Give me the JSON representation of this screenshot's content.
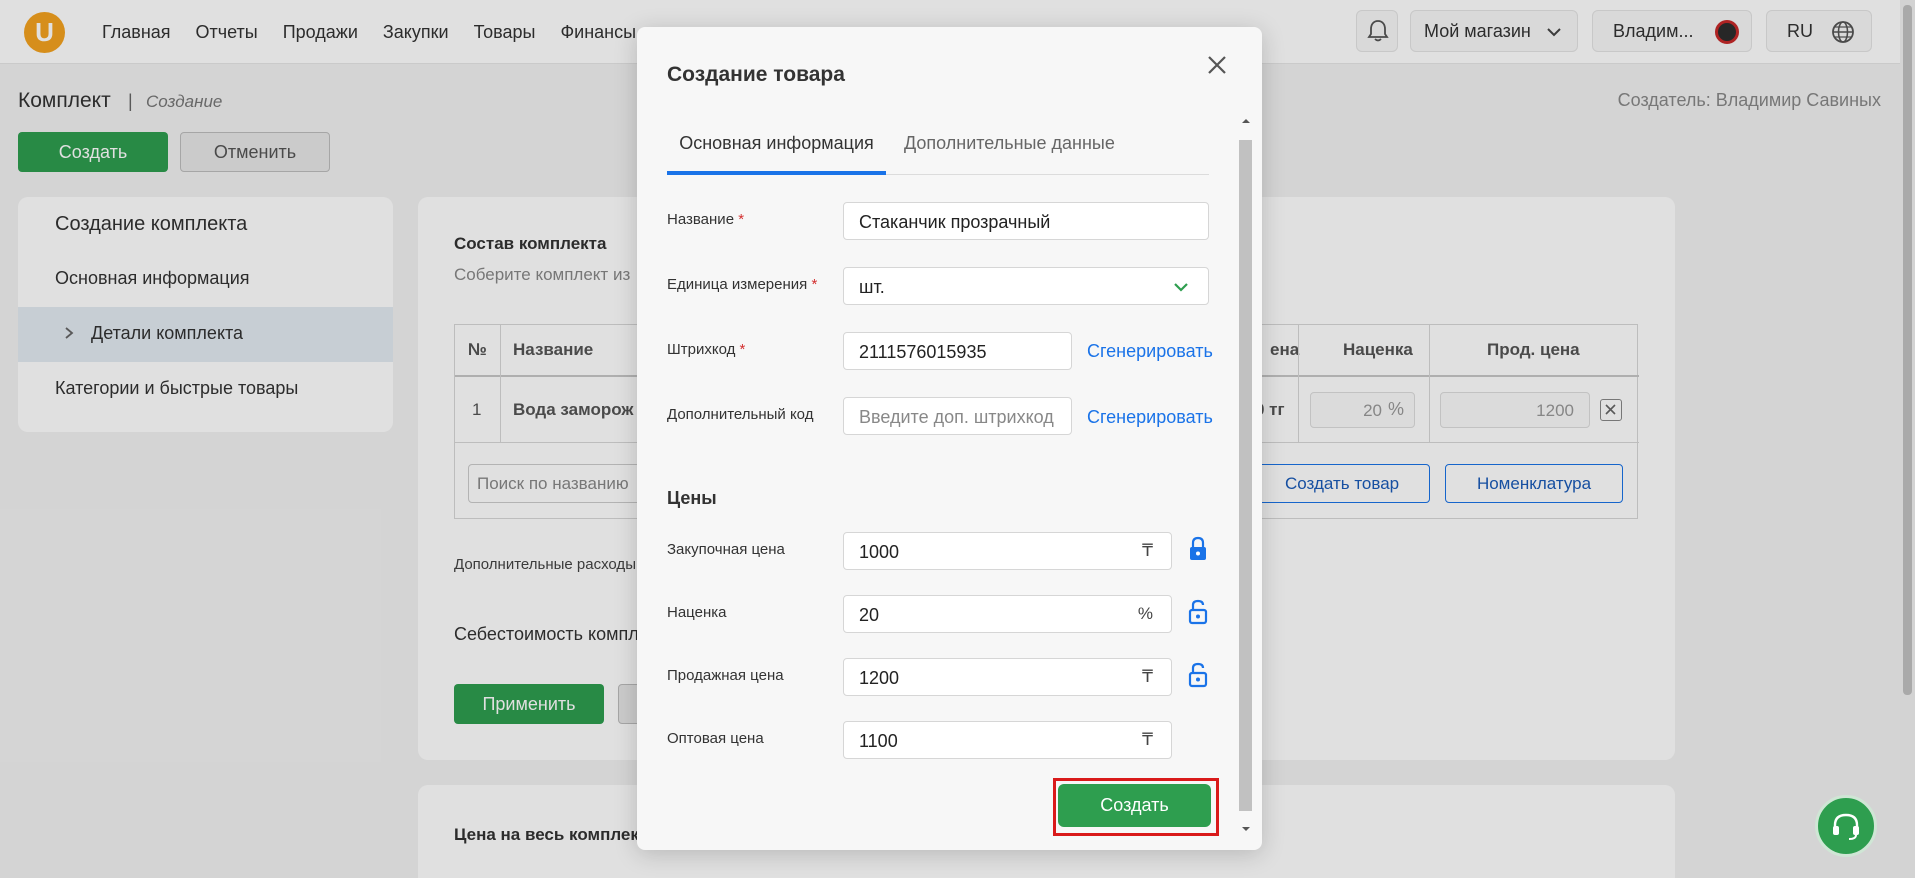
{
  "nav": {
    "logo": "U",
    "items": [
      "Главная",
      "Отчеты",
      "Продажи",
      "Закупки",
      "Товары",
      "Финансы"
    ],
    "store": "Мой магазин",
    "user": "Владим...",
    "lang": "RU"
  },
  "page": {
    "title": "Комплект",
    "separator": "|",
    "subtitle": "Создание",
    "creator": "Создатель: Владимир Савиных",
    "create_btn": "Создать",
    "cancel_btn": "Отменить"
  },
  "sidebar": {
    "heading": "Создание комплекта",
    "items": [
      {
        "label": "Основная информация"
      },
      {
        "label": "Детали комплекта"
      },
      {
        "label": "Категории и быстрые товары"
      }
    ]
  },
  "kit": {
    "section_title": "Состав комплекта",
    "section_hint": "Соберите комплект из",
    "col_num": "№",
    "col_name": "Название",
    "col_price_tail": "ена",
    "col_markup": "Наценка",
    "col_sale": "Прод. цена",
    "row_num": "1",
    "row_name": "Вода заморож",
    "row_price_tail": "0 тг",
    "row_markup": "20",
    "row_markup_unit": "%",
    "row_sale": "1200",
    "search_placeholder": "Поиск по названию",
    "create_product_btn": "Создать товар",
    "nomenclature_btn": "Номенклатура",
    "extra_costs": "Дополнительные расходы",
    "cost_label": "Себестоимость компл",
    "apply_btn": "Применить",
    "price_all": "Цена на весь комплек"
  },
  "modal": {
    "title": "Создание товара",
    "tabs": [
      {
        "label": "Основная информация",
        "active": true
      },
      {
        "label": "Дополнительные данные",
        "active": false
      }
    ],
    "fields": {
      "name_label": "Название",
      "name_value": "Стаканчик прозрачный",
      "unit_label": "Единица измерения",
      "unit_value": "шт.",
      "barcode_label": "Штрихкод",
      "barcode_value": "2111576015935",
      "extra_code_label": "Дополнительный код",
      "extra_code_placeholder": "Введите доп. штрихкод",
      "generate_label": "Сгенерировать",
      "required_mark": "*"
    },
    "prices": {
      "heading": "Цены",
      "purchase_label": "Закупочная цена",
      "purchase_value": "1000",
      "markup_label": "Наценка",
      "markup_value": "20",
      "sale_label": "Продажная цена",
      "sale_value": "1200",
      "wholesale_label": "Оптовая цена",
      "wholesale_value": "1100",
      "currency": "₸",
      "percent": "%"
    },
    "create_btn": "Создать"
  },
  "colors": {
    "green": "#2e9e4f",
    "blue": "#1a73e8",
    "highlight_red": "#d91a1a"
  }
}
